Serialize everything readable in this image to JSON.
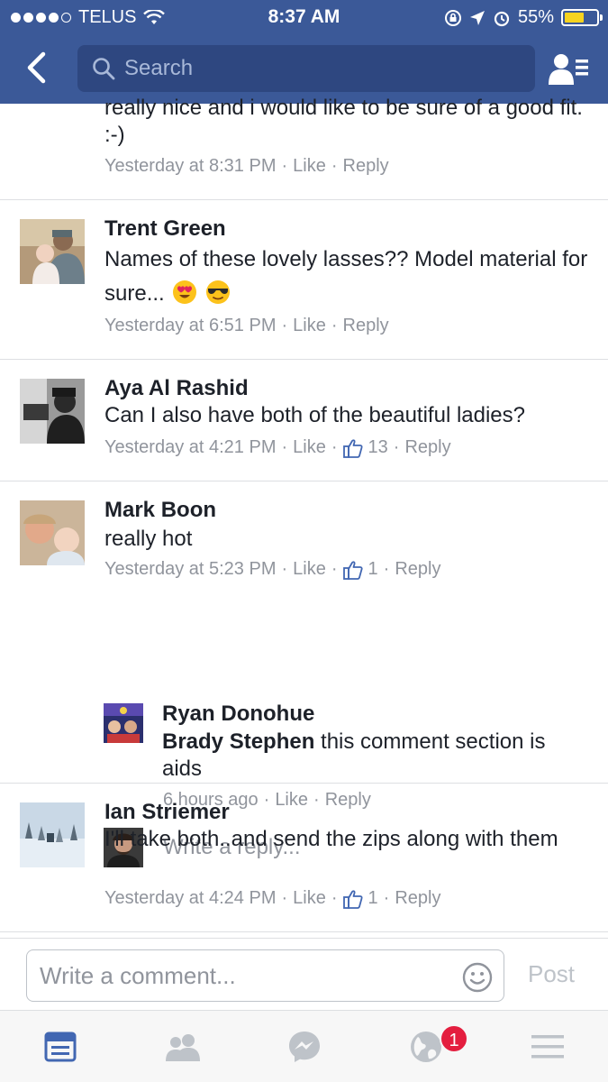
{
  "status_bar": {
    "carrier": "TELUS",
    "time": "8:37 AM",
    "battery": "55%"
  },
  "nav": {
    "search_placeholder": "Search"
  },
  "comments": [
    {
      "text": "really nice and i would like to be sure of a good fit. :-)",
      "time": "Yesterday at 8:31 PM",
      "like": "Like",
      "reply": "Reply"
    },
    {
      "name": "Trent Green",
      "text": "Names of these lovely lasses?? Model material for sure...",
      "time": "Yesterday at 6:51 PM",
      "like": "Like",
      "reply": "Reply"
    },
    {
      "name": "Aya Al Rashid",
      "text": "Can I also have both of the beautiful ladies?",
      "time": "Yesterday at 4:21 PM",
      "like": "Like",
      "likes": "13",
      "reply": "Reply"
    },
    {
      "name": "Mark Boon",
      "text": "really  hot",
      "time": "Yesterday at 5:23 PM",
      "like": "Like",
      "likes": "1",
      "reply": "Reply",
      "replies": [
        {
          "name": "Ryan Donohue",
          "mention": "Brady Stephen",
          "text": " this comment section is aids",
          "time": "6 hours ago",
          "like": "Like",
          "reply": "Reply"
        }
      ],
      "reply_placeholder": "Write a reply..."
    },
    {
      "name": "Ian Striemer",
      "text": "I'll take both..and send the zips along with them",
      "time": "Yesterday at 4:24 PM",
      "like": "Like",
      "likes": "1",
      "reply": "Reply"
    }
  ],
  "composer": {
    "placeholder": "Write a comment...",
    "post_label": "Post"
  },
  "tabbar": {
    "notifications_badge": "1"
  },
  "colors": {
    "brand": "#3b5998",
    "meta_text": "#90949c",
    "badge": "#e41e3f"
  }
}
